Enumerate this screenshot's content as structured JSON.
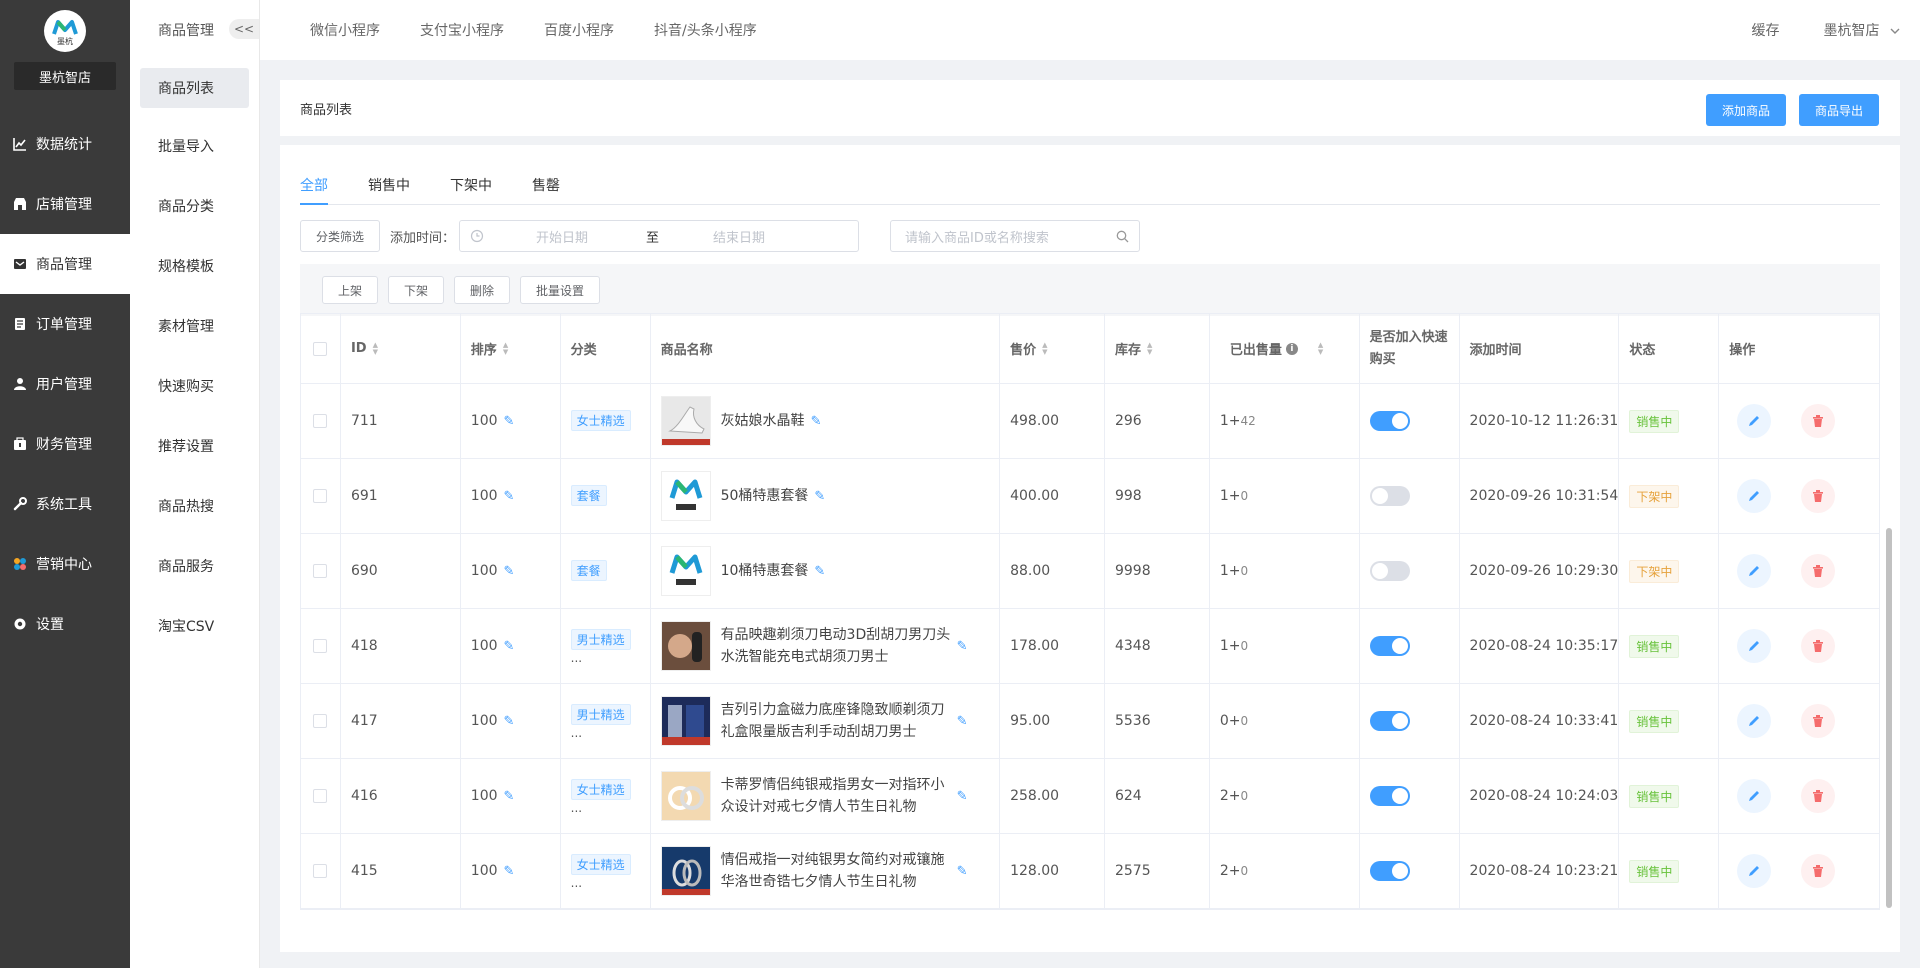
{
  "sidebar": {
    "store_name": "墨杭智店",
    "logo_text": "墨杭",
    "items": [
      {
        "label": "数据统计",
        "icon": "chart-icon"
      },
      {
        "label": "店铺管理",
        "icon": "shop-icon"
      },
      {
        "label": "商品管理",
        "icon": "goods-icon",
        "active": true
      },
      {
        "label": "订单管理",
        "icon": "order-icon"
      },
      {
        "label": "用户管理",
        "icon": "user-icon"
      },
      {
        "label": "财务管理",
        "icon": "finance-icon"
      },
      {
        "label": "系统工具",
        "icon": "wrench-icon"
      },
      {
        "label": "营销中心",
        "icon": "marketing-icon"
      },
      {
        "label": "设置",
        "icon": "settings-icon"
      }
    ]
  },
  "subnav": {
    "title": "商品管理",
    "collapse_label": "<<",
    "items": [
      "商品列表",
      "批量导入",
      "商品分类",
      "规格模板",
      "素材管理",
      "快速购买",
      "推荐设置",
      "商品热搜",
      "商品服务",
      "淘宝CSV"
    ]
  },
  "topbar": {
    "tabs": [
      "微信小程序",
      "支付宝小程序",
      "百度小程序",
      "抖音/头条小程序"
    ],
    "cache_label": "缓存",
    "store_label": "墨杭智店"
  },
  "page": {
    "title": "商品列表",
    "add_button": "添加商品",
    "export_button": "商品导出"
  },
  "tabs": [
    "全部",
    "销售中",
    "下架中",
    "售罄"
  ],
  "filters": {
    "category_button": "分类筛选",
    "date_label": "添加时间：",
    "start_placeholder": "开始日期",
    "separator": "至",
    "end_placeholder": "结束日期",
    "search_placeholder": "请输入商品ID或名称搜索"
  },
  "bulk": {
    "on_shelf": "上架",
    "off_shelf": "下架",
    "delete": "删除",
    "batch": "批量设置"
  },
  "table": {
    "headers": {
      "id": "ID",
      "sort": "排序",
      "category": "分类",
      "name": "商品名称",
      "price": "售价",
      "stock": "库存",
      "sold": "已出售量",
      "quick_buy": "是否加入快速购买",
      "added": "添加时间",
      "status": "状态",
      "actions": "操作"
    },
    "rows": [
      {
        "id": "711",
        "sort": "100",
        "category": "女士精选",
        "more": "",
        "name": "灰姑娘水晶鞋",
        "price": "498.00",
        "stock": "296",
        "sold_a": "1+",
        "sold_b": "42",
        "quick": true,
        "added": "2020-10-12 11:26:31",
        "status": "销售中",
        "status_on": true,
        "thumb": "shoe"
      },
      {
        "id": "691",
        "sort": "100",
        "category": "套餐",
        "more": "",
        "name": "50桶特惠套餐",
        "price": "400.00",
        "stock": "998",
        "sold_a": "1+",
        "sold_b": "0",
        "quick": false,
        "added": "2020-09-26 10:31:54",
        "status": "下架中",
        "status_on": false,
        "thumb": "logo"
      },
      {
        "id": "690",
        "sort": "100",
        "category": "套餐",
        "more": "",
        "name": "10桶特惠套餐",
        "price": "88.00",
        "stock": "9998",
        "sold_a": "1+",
        "sold_b": "0",
        "quick": false,
        "added": "2020-09-26 10:29:30",
        "status": "下架中",
        "status_on": false,
        "thumb": "logo"
      },
      {
        "id": "418",
        "sort": "100",
        "category": "男士精选",
        "more": "...",
        "name": "有品映趣剃须刀电动3D刮胡刀男刀头水洗智能充电式胡须刀男士",
        "price": "178.00",
        "stock": "4348",
        "sold_a": "1+",
        "sold_b": "0",
        "quick": true,
        "added": "2020-08-24 10:35:17",
        "status": "销售中",
        "status_on": true,
        "thumb": "razor"
      },
      {
        "id": "417",
        "sort": "100",
        "category": "男士精选",
        "more": "...",
        "name": "吉列引力盒磁力底座锋隐致顺剃须刀礼盒限量版吉利手动刮胡刀男士",
        "price": "95.00",
        "stock": "5536",
        "sold_a": "0+",
        "sold_b": "0",
        "quick": true,
        "added": "2020-08-24 10:33:41",
        "status": "销售中",
        "status_on": true,
        "thumb": "box"
      },
      {
        "id": "416",
        "sort": "100",
        "category": "女士精选",
        "more": "...",
        "name": "卡蒂罗情侣纯银戒指男女一对指环小众设计对戒七夕情人节生日礼物",
        "price": "258.00",
        "stock": "624",
        "sold_a": "2+",
        "sold_b": "0",
        "quick": true,
        "added": "2020-08-24 10:24:03",
        "status": "销售中",
        "status_on": true,
        "thumb": "ring"
      },
      {
        "id": "415",
        "sort": "100",
        "category": "女士精选",
        "more": "...",
        "name": "情侣戒指一对纯银男女简约对戒镶施华洛世奇锆七夕情人节生日礼物",
        "price": "128.00",
        "stock": "2575",
        "sold_a": "2+",
        "sold_b": "0",
        "quick": true,
        "added": "2020-08-24 10:23:21",
        "status": "销售中",
        "status_on": true,
        "thumb": "ring2"
      }
    ]
  },
  "colors": {
    "primary": "#409eff",
    "sidebar_bg": "#3a3a3a",
    "danger": "#f56c6c",
    "success": "#67c23a",
    "warning": "#e6a23c"
  }
}
